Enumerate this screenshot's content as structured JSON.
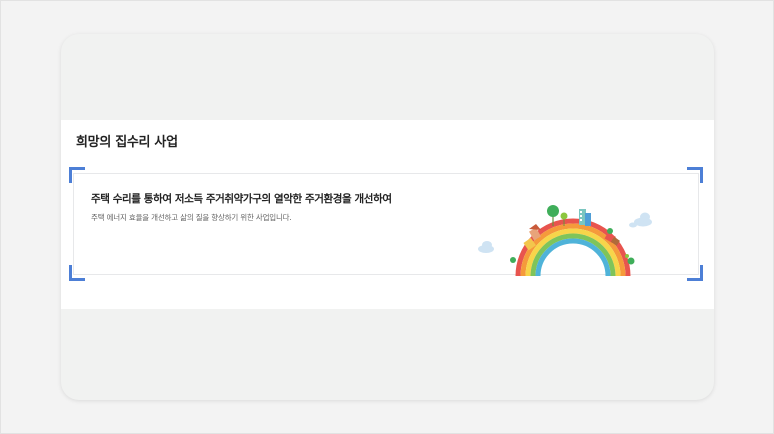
{
  "section": {
    "title": "희망의 집수리 사업"
  },
  "info": {
    "heading": "주택 수리를 통하여 저소득 주거취약가구의 열악한 주거환경을 개선하여",
    "description": "주택 에너지 효율을 개선하고 삶의 질을 향상하기 위한 사업입니다."
  },
  "illustration": {
    "icon": "rainbow-city-illustration",
    "colors": [
      "#e8544e",
      "#f59a3b",
      "#f7d54a",
      "#7fc45a",
      "#4fb3d9"
    ]
  },
  "accent_color": "#4d7fd6"
}
